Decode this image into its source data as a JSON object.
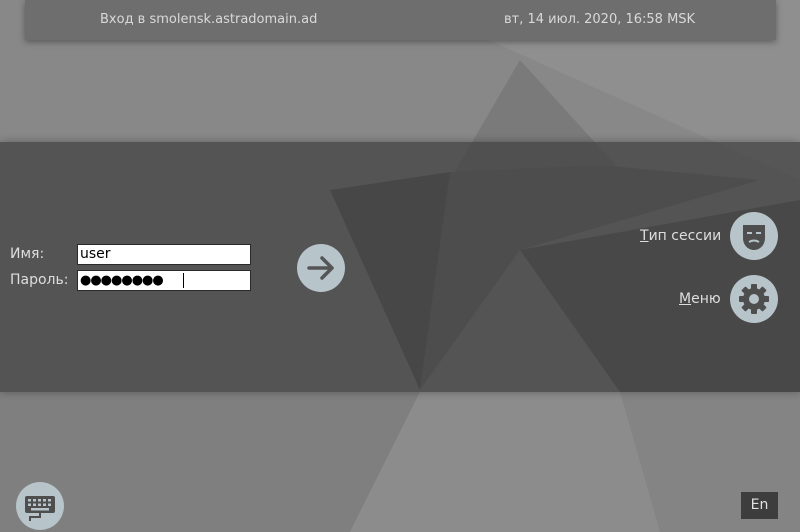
{
  "header": {
    "login_title": "Вход в smolensk.astradomain.ad",
    "datetime": "вт, 14 июл. 2020, 16:58 MSK"
  },
  "login_form": {
    "username_label": "Имя:",
    "username_value": "user",
    "password_label": "Пароль:",
    "password_masked": "●●●●●●●●"
  },
  "side_menu": {
    "session_type_first": "Т",
    "session_type_rest": "ип сессии",
    "menu_first": "М",
    "menu_rest": "еню"
  },
  "footer": {
    "language": "En"
  },
  "icons": {
    "submit": "arrow-right-icon",
    "session_type": "mask-icon",
    "menu": "gear-icon",
    "keyboard": "keyboard-icon"
  },
  "colors": {
    "button_fill": "#b7c4ca",
    "band": "#404040",
    "background": "#878787"
  }
}
